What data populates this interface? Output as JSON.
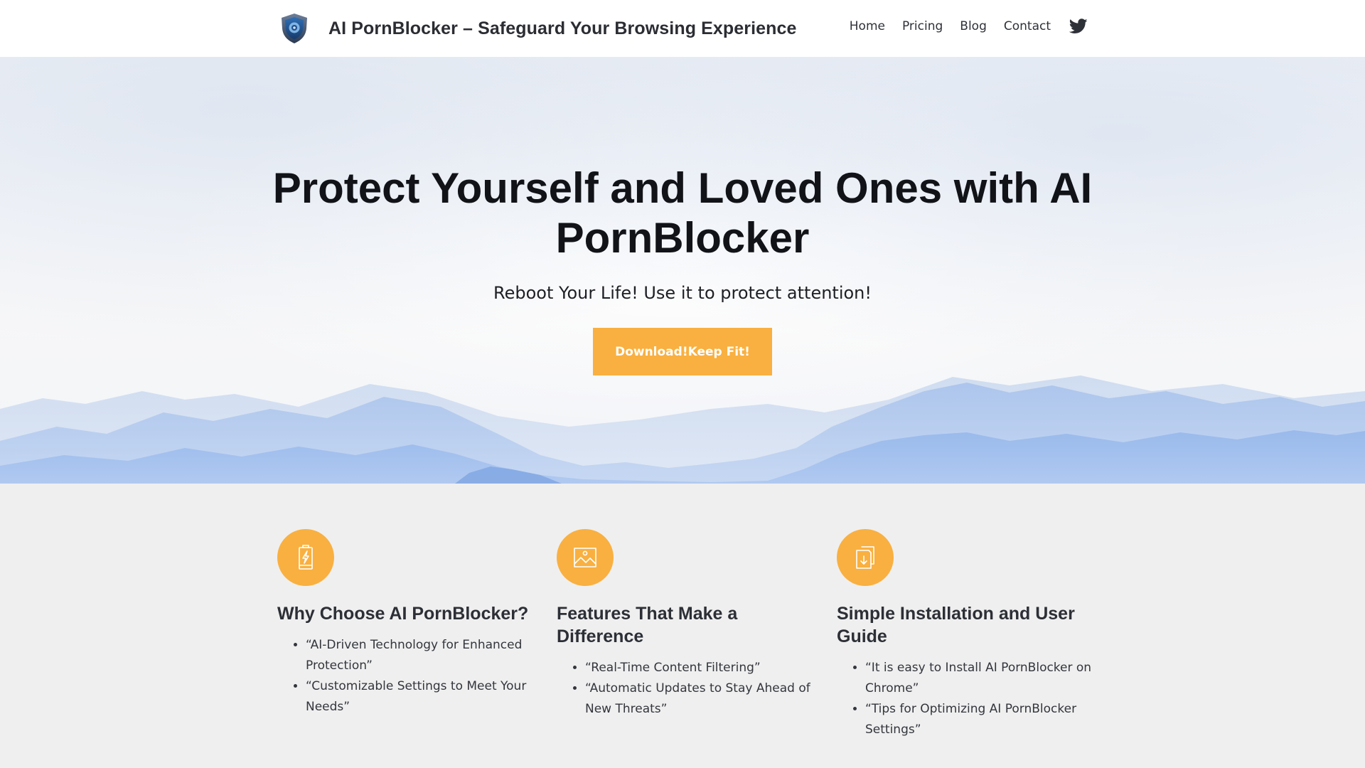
{
  "header": {
    "logo_icon": "shield-logo-icon",
    "title": "AI PornBlocker – Safeguard Your Browsing Experience",
    "nav": [
      {
        "label": "Home"
      },
      {
        "label": "Pricing"
      },
      {
        "label": "Blog"
      },
      {
        "label": "Contact"
      }
    ],
    "social_icon": "twitter-icon"
  },
  "hero": {
    "title": "Protect Yourself and Loved Ones with AI PornBlocker",
    "subtitle": "Reboot Your Life! Use it to protect attention!",
    "cta_label": "Download!Keep Fit!",
    "background": "misty-blue-mountains"
  },
  "features": [
    {
      "icon": "battery-charging-icon",
      "title": "Why Choose AI PornBlocker?",
      "items": [
        "“AI-Driven Technology for Enhanced Protection”",
        "“Customizable Settings to Meet Your Needs”"
      ]
    },
    {
      "icon": "image-icon",
      "title": "Features That Make a Difference",
      "items": [
        "“Real-Time Content Filtering”",
        "“Automatic Updates to Stay Ahead of New Threats”"
      ]
    },
    {
      "icon": "document-download-icon",
      "title": "Simple Installation and User Guide",
      "items": [
        "“It is easy to Install AI PornBlocker on Chrome”",
        "“Tips for Optimizing AI PornBlocker Settings”"
      ]
    }
  ],
  "colors": {
    "accent": "#f9b040",
    "text_dark": "#111318",
    "features_bg": "#efefef",
    "mountain_blue": "#8fb3ea"
  }
}
